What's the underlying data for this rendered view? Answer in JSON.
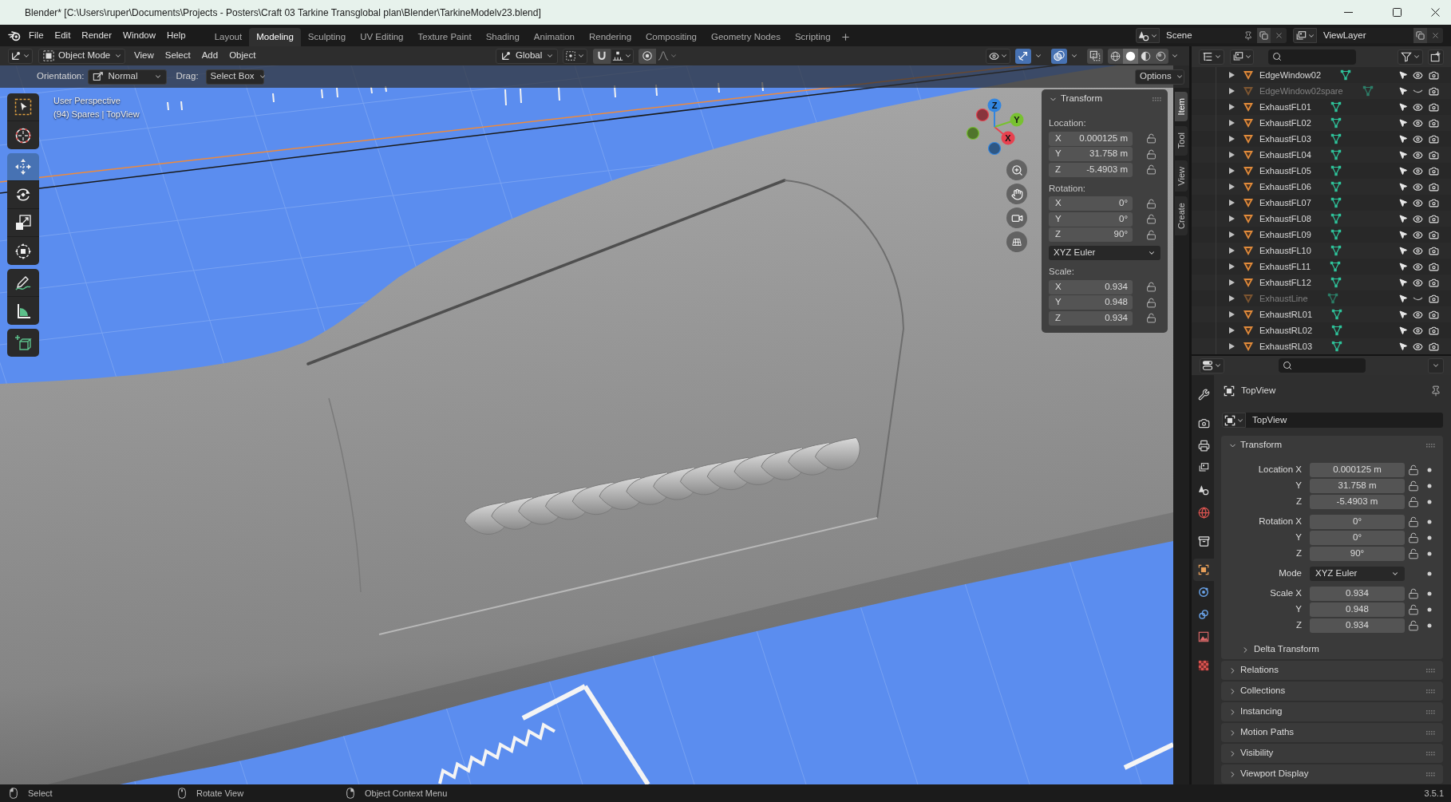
{
  "window": {
    "title": "Blender* [C:\\Users\\ruper\\Documents\\Projects - Posters\\Craft 03 Tarkine Transglobal plan\\Blender\\TarkineModelv23.blend]"
  },
  "menu_bar": {
    "menus": [
      "File",
      "Edit",
      "Render",
      "Window",
      "Help"
    ]
  },
  "workspaces": [
    {
      "label": "Layout",
      "selected": false
    },
    {
      "label": "Modeling",
      "selected": true
    },
    {
      "label": "Sculpting",
      "selected": false
    },
    {
      "label": "UV Editing",
      "selected": false
    },
    {
      "label": "Texture Paint",
      "selected": false
    },
    {
      "label": "Shading",
      "selected": false
    },
    {
      "label": "Animation",
      "selected": false
    },
    {
      "label": "Rendering",
      "selected": false
    },
    {
      "label": "Compositing",
      "selected": false
    },
    {
      "label": "Geometry Nodes",
      "selected": false
    },
    {
      "label": "Scripting",
      "selected": false
    }
  ],
  "scene": {
    "name": "Scene"
  },
  "view_layer": {
    "name": "ViewLayer"
  },
  "viewport_header": {
    "mode": "Object Mode",
    "menus": [
      "View",
      "Select",
      "Add",
      "Object"
    ],
    "transform_orientation": "Global",
    "snap": {
      "on": false
    },
    "proportional_editing": {
      "on": false
    },
    "toggles": [
      {
        "kind": "gizmos",
        "on": true
      },
      {
        "kind": "overlays",
        "on": true
      },
      {
        "kind": "xray",
        "on": false
      }
    ],
    "shading": [
      {
        "kind": "wireframe",
        "selected": false
      },
      {
        "kind": "solid",
        "selected": true
      },
      {
        "kind": "material",
        "selected": false
      },
      {
        "kind": "rendered",
        "selected": false
      }
    ]
  },
  "tool_settings": {
    "orientation_label": "Orientation:",
    "orientation": "Normal",
    "drag_label": "Drag:",
    "drag": "Select Box",
    "options": "Options"
  },
  "toolbar": [
    {
      "tools": [
        {
          "kind": "select_box",
          "selected": false
        },
        {
          "kind": "cursor",
          "selected": false
        }
      ]
    },
    {
      "tools": [
        {
          "kind": "move",
          "selected": true
        },
        {
          "kind": "rotate",
          "selected": false
        },
        {
          "kind": "scale",
          "selected": false
        },
        {
          "kind": "transform",
          "selected": false
        }
      ]
    },
    {
      "tools": [
        {
          "kind": "annotate",
          "selected": false
        },
        {
          "kind": "measure",
          "selected": false
        }
      ]
    },
    {
      "tools": [
        {
          "kind": "add_cube",
          "selected": false
        }
      ]
    }
  ],
  "viewport": {
    "view_name": "User Perspective",
    "info": "(94) Spares | TopView"
  },
  "navigation_gizmo": {
    "axes": [
      {
        "label": "X",
        "color": "#e8414f"
      },
      {
        "label": "Y",
        "color": "#78c130"
      },
      {
        "label": "Z",
        "color": "#3386e0"
      }
    ]
  },
  "sidebar": {
    "panel": {
      "title": "Transform",
      "expanded": true,
      "sections": [
        {
          "label": "Location:",
          "fields": [
            {
              "axis": "X",
              "value": "0.000125 m"
            },
            {
              "axis": "Y",
              "value": "31.758 m"
            },
            {
              "axis": "Z",
              "value": "-5.4903 m"
            }
          ]
        },
        {
          "label": "Rotation:",
          "fields": [
            {
              "axis": "X",
              "value": "0°"
            },
            {
              "axis": "Y",
              "value": "0°"
            },
            {
              "axis": "Z",
              "value": "90°"
            }
          ],
          "mode": "XYZ Euler"
        },
        {
          "label": "Scale:",
          "fields": [
            {
              "axis": "X",
              "value": "0.934"
            },
            {
              "axis": "Y",
              "value": "0.948"
            },
            {
              "axis": "Z",
              "value": "0.934"
            }
          ]
        }
      ]
    },
    "tabs": [
      {
        "label": "Item",
        "selected": true
      },
      {
        "label": "Tool",
        "selected": false
      },
      {
        "label": "View",
        "selected": false
      },
      {
        "label": "Create",
        "selected": false
      }
    ]
  },
  "outliner": {
    "rows": [
      {
        "name": "EdgeWindow02",
        "visible": true,
        "expanded": false
      },
      {
        "name": "EdgeWindow02spare",
        "visible": false,
        "expanded": false
      },
      {
        "name": "ExhaustFL01",
        "visible": true,
        "expanded": false
      },
      {
        "name": "ExhaustFL02",
        "visible": true,
        "expanded": false
      },
      {
        "name": "ExhaustFL03",
        "visible": true,
        "expanded": false
      },
      {
        "name": "ExhaustFL04",
        "visible": true,
        "expanded": false
      },
      {
        "name": "ExhaustFL05",
        "visible": true,
        "expanded": false
      },
      {
        "name": "ExhaustFL06",
        "visible": true,
        "expanded": false
      },
      {
        "name": "ExhaustFL07",
        "visible": true,
        "expanded": false
      },
      {
        "name": "ExhaustFL08",
        "visible": true,
        "expanded": false
      },
      {
        "name": "ExhaustFL09",
        "visible": true,
        "expanded": false
      },
      {
        "name": "ExhaustFL10",
        "visible": true,
        "expanded": false
      },
      {
        "name": "ExhaustFL11",
        "visible": true,
        "expanded": false
      },
      {
        "name": "ExhaustFL12",
        "visible": true,
        "expanded": false
      },
      {
        "name": "ExhaustLine",
        "visible": false,
        "expanded": false
      },
      {
        "name": "ExhaustRL01",
        "visible": true,
        "expanded": false
      },
      {
        "name": "ExhaustRL02",
        "visible": true,
        "expanded": false
      },
      {
        "name": "ExhaustRL03",
        "visible": true,
        "expanded": false
      }
    ]
  },
  "properties": {
    "tab_groups": [
      {
        "tabs": [
          {
            "kind": "tool",
            "selected": false
          }
        ]
      },
      {
        "tabs": [
          {
            "kind": "render",
            "selected": false
          },
          {
            "kind": "output",
            "selected": false
          },
          {
            "kind": "view_layer",
            "selected": false
          },
          {
            "kind": "scene",
            "selected": false
          },
          {
            "kind": "world",
            "selected": false
          }
        ]
      },
      {
        "tabs": [
          {
            "kind": "collection",
            "selected": false
          }
        ]
      },
      {
        "tabs": [
          {
            "kind": "object",
            "selected": true
          },
          {
            "kind": "physics",
            "selected": false
          },
          {
            "kind": "constraints",
            "selected": false
          },
          {
            "kind": "data",
            "selected": false
          }
        ]
      },
      {
        "tabs": [
          {
            "kind": "texture",
            "selected": false
          }
        ]
      }
    ],
    "object_name": "TopView",
    "data_name": "TopView",
    "panels": [
      {
        "title": "Transform",
        "expanded": true,
        "groups": [
          {
            "rows": [
              {
                "kind": "number",
                "label": "Location X",
                "value": "0.000125 m"
              },
              {
                "kind": "number",
                "label": "Y",
                "value": "31.758 m"
              },
              {
                "kind": "number",
                "label": "Z",
                "value": "-5.4903 m"
              }
            ]
          },
          {
            "rows": [
              {
                "kind": "number",
                "label": "Rotation X",
                "value": "0°"
              },
              {
                "kind": "number",
                "label": "Y",
                "value": "0°"
              },
              {
                "kind": "number",
                "label": "Z",
                "value": "90°"
              }
            ]
          },
          {
            "rows": [
              {
                "kind": "dropdown",
                "label": "Mode",
                "value": "XYZ Euler"
              }
            ]
          },
          {
            "rows": [
              {
                "kind": "number",
                "label": "Scale X",
                "value": "0.934"
              },
              {
                "kind": "number",
                "label": "Y",
                "value": "0.948"
              },
              {
                "kind": "number",
                "label": "Z",
                "value": "0.934"
              }
            ]
          }
        ],
        "subpanels": [
          {
            "title": "Delta Transform",
            "expanded": false
          }
        ]
      },
      {
        "title": "Relations",
        "expanded": false
      },
      {
        "title": "Collections",
        "expanded": false
      },
      {
        "title": "Instancing",
        "expanded": false
      },
      {
        "title": "Motion Paths",
        "expanded": false
      },
      {
        "title": "Visibility",
        "expanded": false
      },
      {
        "title": "Viewport Display",
        "expanded": false
      }
    ]
  },
  "status_bar": {
    "hints": [
      {
        "kind": "left_click",
        "label": "Select"
      },
      {
        "kind": "middle_click",
        "label": "Rotate View"
      },
      {
        "kind": "right_click",
        "label": "Object Context Menu"
      }
    ],
    "version": "3.5.1"
  }
}
